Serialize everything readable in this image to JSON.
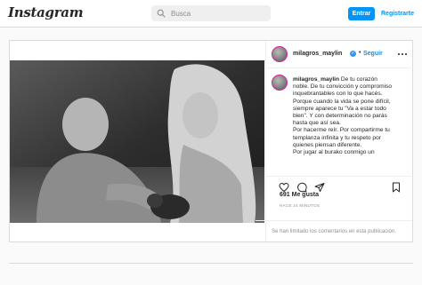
{
  "header": {
    "logo": "Instagram",
    "search_placeholder": "Busca",
    "login_label": "Entrar",
    "signup_label": "Registrarte"
  },
  "post": {
    "username": "milagros_maylin",
    "follow_label": "Seguir",
    "caption_lines": [
      "De tu corazón",
      "noble. De tu convicción y compromiso",
      "inquebrantables con lo que hacés.",
      "Porque cuando la vida se pone difícil,",
      "siempre aparece tu \"Va a estar todo",
      "bien\". Y con determinación no parás",
      "hasta que así sea.",
      "Por hacerme reír. Por compartirme tu",
      "templanza infinita y tu respeto por",
      "quienes piensan diferente.",
      "Por jugar al burako conmigo un"
    ],
    "likes": "691 Me gusta",
    "timestamp": "HACE 24 MINUTOS",
    "comments_disabled": "Se han limitado los comentarios en esta publicación."
  },
  "icons": {
    "search": "search-icon",
    "verified": "verified-badge-icon",
    "more": "more-options-icon",
    "like": "heart-icon",
    "comment": "comment-icon",
    "share": "share-icon",
    "save": "bookmark-icon"
  },
  "colors": {
    "accent": "#0095f6",
    "border": "#dbdbdb",
    "text": "#262626",
    "muted": "#8e8e8e"
  }
}
